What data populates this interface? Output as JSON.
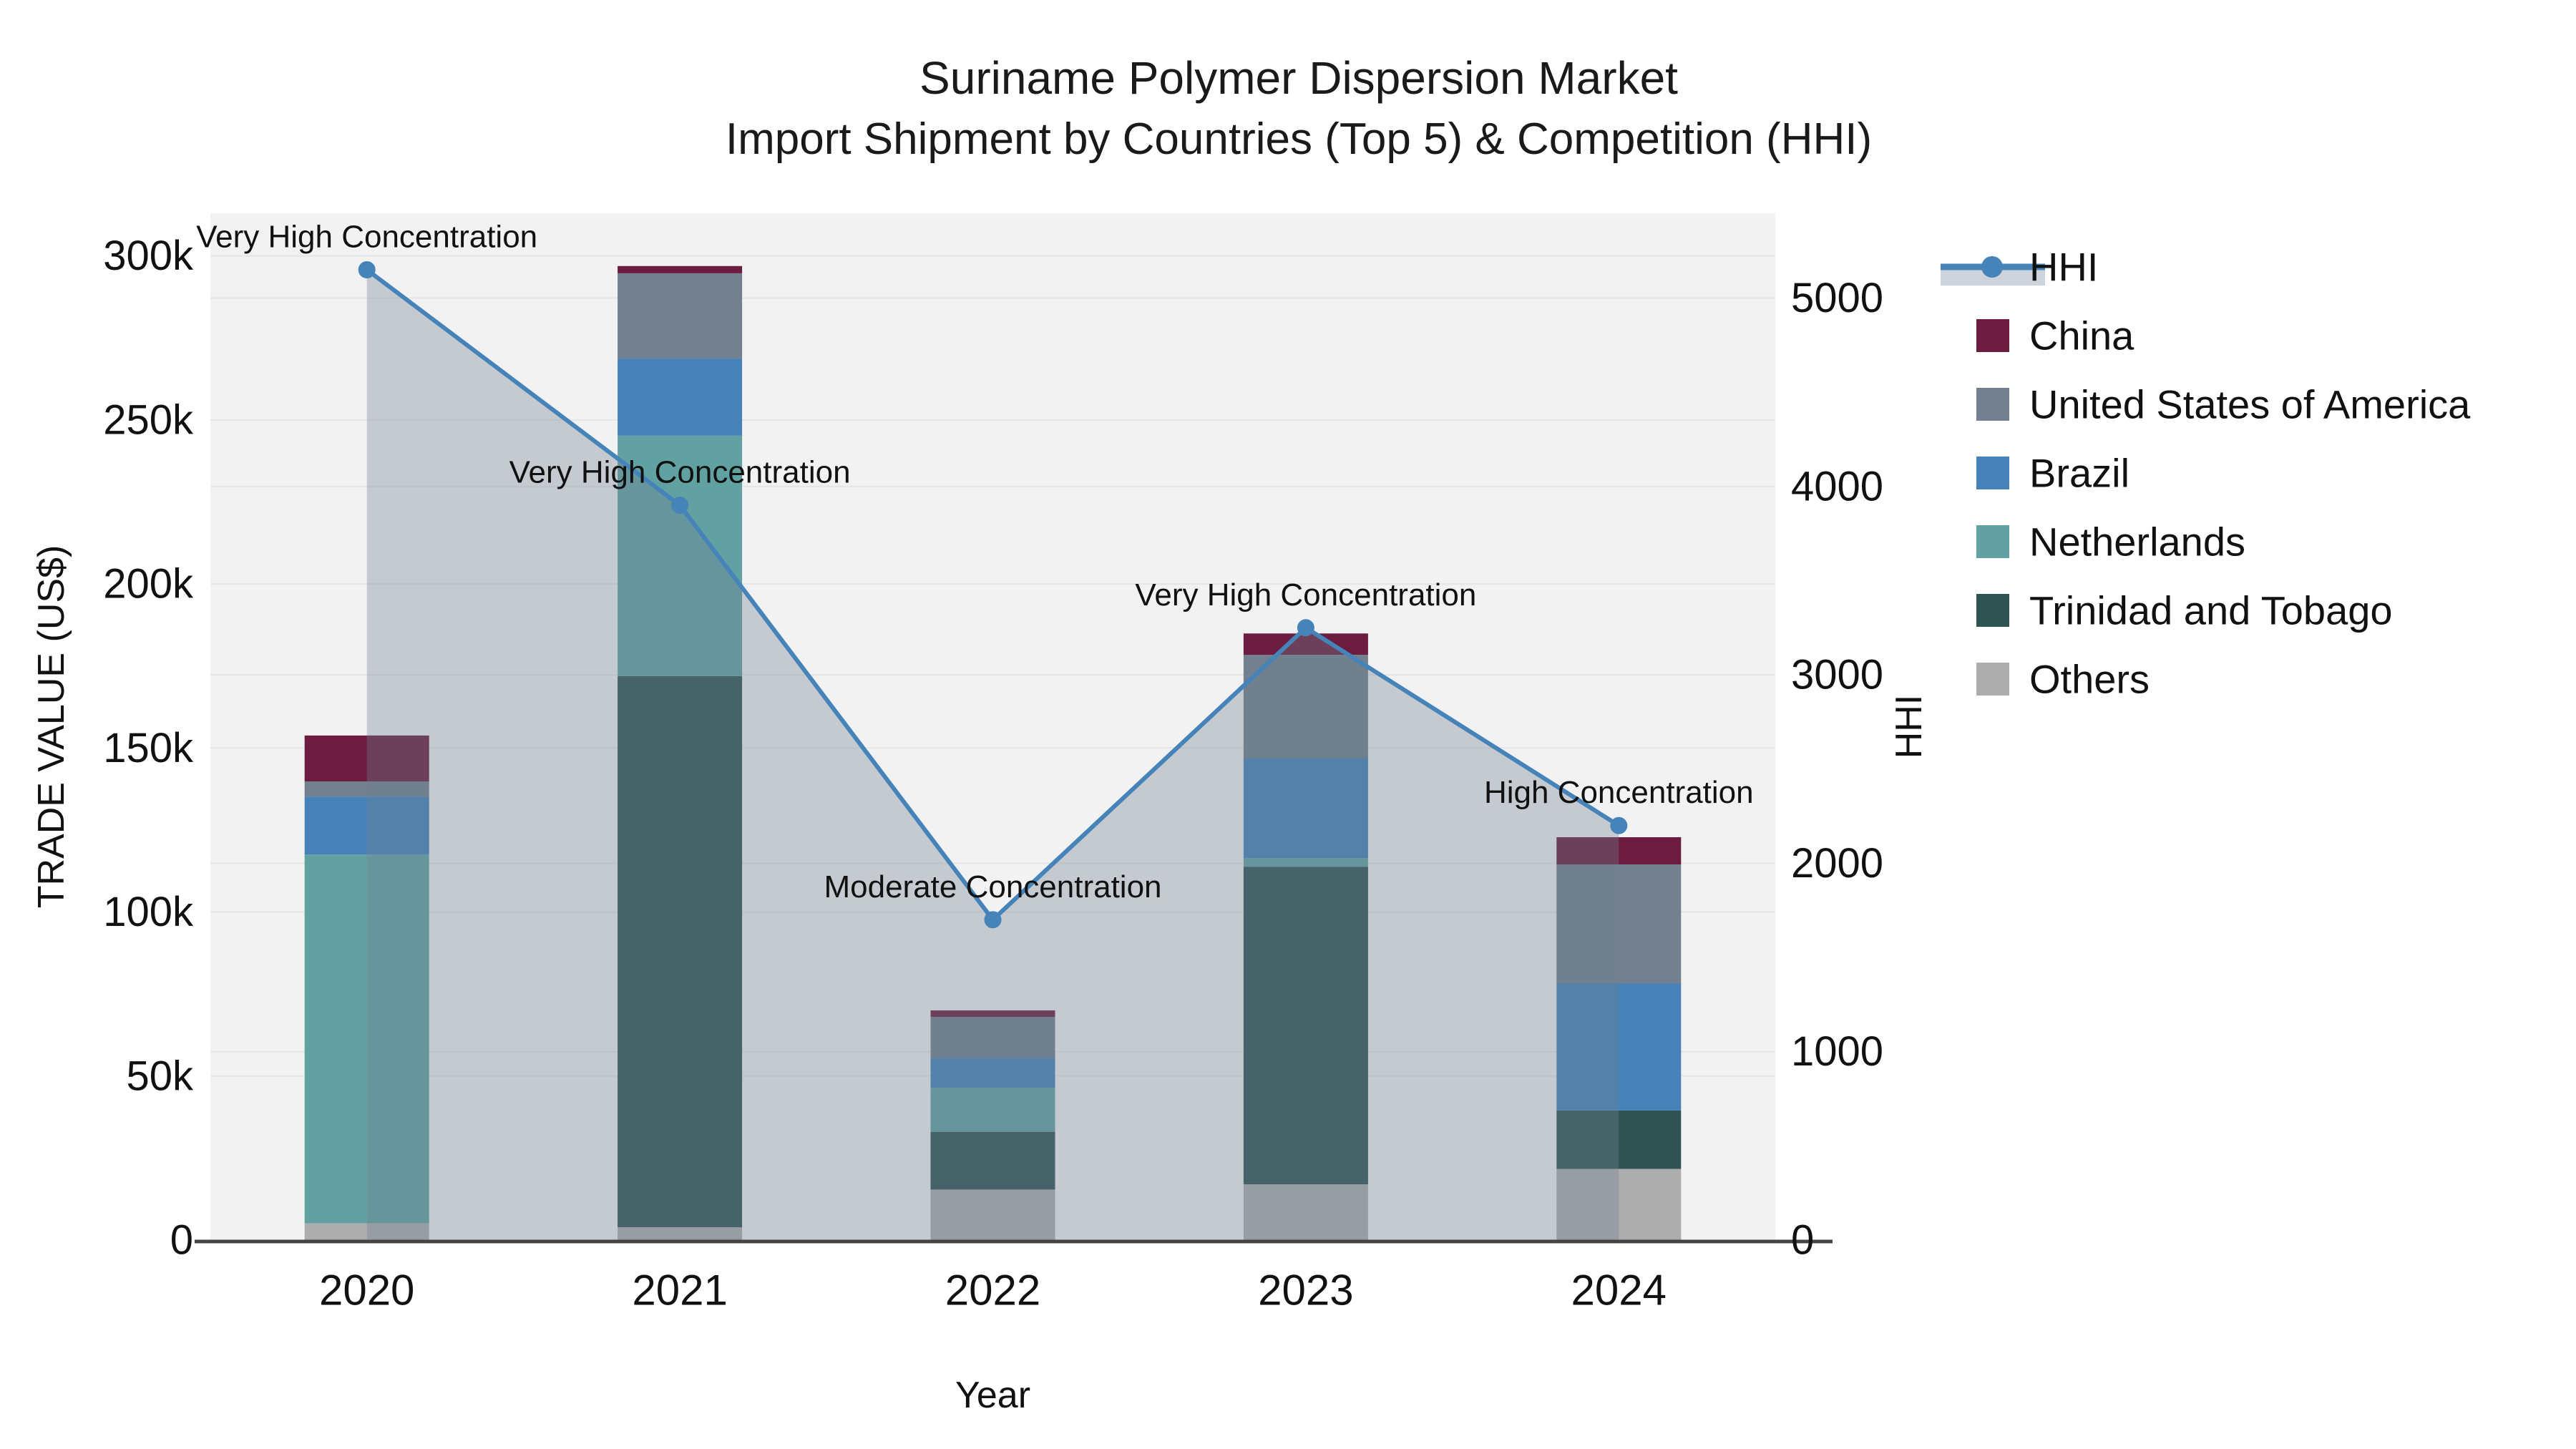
{
  "chart_data": {
    "type": "bar+line",
    "title": "Suriname Polymer Dispersion Market",
    "subtitle": "Import Shipment by Countries (Top 5) & Competition (HHI)",
    "xlabel": "Year",
    "ylabel_left": "TRADE VALUE (US$)",
    "ylabel_right": "HHI",
    "categories": [
      "2020",
      "2021",
      "2022",
      "2023",
      "2024"
    ],
    "bar_unit": "US$",
    "stack_order": [
      "Others",
      "Trinidad and Tobago",
      "Netherlands",
      "Brazil",
      "United States of America",
      "China"
    ],
    "series": [
      {
        "name": "China",
        "color": "#6B1C3F",
        "values": [
          14000,
          2200,
          2000,
          6500,
          8300
        ]
      },
      {
        "name": "United States of America",
        "color": "#72808F",
        "values": [
          4600,
          26000,
          12500,
          31500,
          36300
        ]
      },
      {
        "name": "Brazil",
        "color": "#4681B8",
        "values": [
          17700,
          23500,
          9100,
          30500,
          38700
        ]
      },
      {
        "name": "Netherlands",
        "color": "#62A1A1",
        "values": [
          112400,
          73300,
          13400,
          2600,
          0
        ]
      },
      {
        "name": "Trinidad and Tobago",
        "color": "#2F5353",
        "values": [
          0,
          168000,
          17600,
          96800,
          17800
        ]
      },
      {
        "name": "Others",
        "color": "#ADADAD",
        "values": [
          5100,
          3900,
          15400,
          17000,
          21700
        ]
      }
    ],
    "hhi": {
      "name": "HHI",
      "values": [
        5150,
        3900,
        1700,
        3250,
        2200
      ],
      "line_color": "#4583B8",
      "fill_color": "rgba(112,128,144,0.35)",
      "legend_band_color": "#CDD3DC"
    },
    "annotations": [
      {
        "x": "2020",
        "label": "Very High Concentration"
      },
      {
        "x": "2021",
        "label": "Very High Concentration"
      },
      {
        "x": "2022",
        "label": "Moderate Concentration"
      },
      {
        "x": "2023",
        "label": "Very High Concentration"
      },
      {
        "x": "2024",
        "label": "High Concentration"
      }
    ],
    "y_left_axis": {
      "tick_labels": [
        "0",
        "50k",
        "100k",
        "150k",
        "200k",
        "250k",
        "300k"
      ],
      "tick_values": [
        0,
        50000,
        100000,
        150000,
        200000,
        250000,
        300000
      ],
      "range": [
        0,
        313000
      ],
      "grid": true
    },
    "y_right_axis": {
      "tick_labels": [
        "0",
        "1000",
        "2000",
        "3000",
        "4000",
        "5000"
      ],
      "tick_values": [
        0,
        1000,
        2000,
        3000,
        4000,
        5000
      ],
      "range": [
        0,
        5450
      ],
      "grid": true
    },
    "legend_position": "right",
    "legend_entries": [
      "HHI",
      "China",
      "United States of America",
      "Brazil",
      "Netherlands",
      "Trinidad and Tobago",
      "Others"
    ],
    "plot_bg_color": "#F2F2F2",
    "grid_color": "#E3E6E6",
    "axis_line_color": "#444444",
    "text_color": "#111111"
  }
}
